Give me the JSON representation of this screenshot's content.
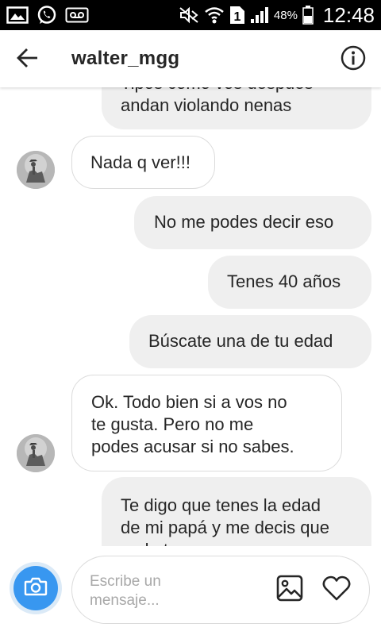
{
  "status_bar": {
    "icons": [
      "image-icon",
      "whatsapp-icon",
      "voicemail-icon",
      "mute-icon",
      "wifi-icon",
      "sim-icon",
      "signal-icon",
      "battery-icon"
    ],
    "sim_label": "1",
    "battery": "48%",
    "time": "12:48"
  },
  "header": {
    "title": "walter_mgg",
    "back_icon": "arrow-left-icon",
    "info_icon": "info-icon"
  },
  "messages": [
    {
      "direction": "outgoing",
      "text": "andan violando nenas",
      "partial_top_text": "Tipos como vos después"
    },
    {
      "direction": "incoming",
      "text": "Nada q ver!!!",
      "avatar": true
    },
    {
      "direction": "outgoing",
      "text": "No me podes decir eso"
    },
    {
      "direction": "outgoing",
      "text": "Tenes 40 años"
    },
    {
      "direction": "outgoing",
      "text": "Búscate una de tu edad"
    },
    {
      "direction": "incoming",
      "lines": [
        "Ok. Todo bien si a vos no",
        "te gusta. Pero no me",
        "podes acusar si no sabes."
      ],
      "avatar": true
    },
    {
      "direction": "outgoing",
      "lines": [
        "Te digo que tenes la edad",
        "de mi papá y me decis que",
        "no la tenes"
      ]
    }
  ],
  "composer": {
    "placeholder": "Escribe un mensaje...",
    "camera_icon": "camera-icon",
    "gallery_icon": "gallery-icon",
    "heart_icon": "heart-icon"
  },
  "colors": {
    "accent": "#3897f0",
    "outgoing_bubble": "#efefef",
    "incoming_border": "#dbdbdb",
    "text": "#262626"
  }
}
